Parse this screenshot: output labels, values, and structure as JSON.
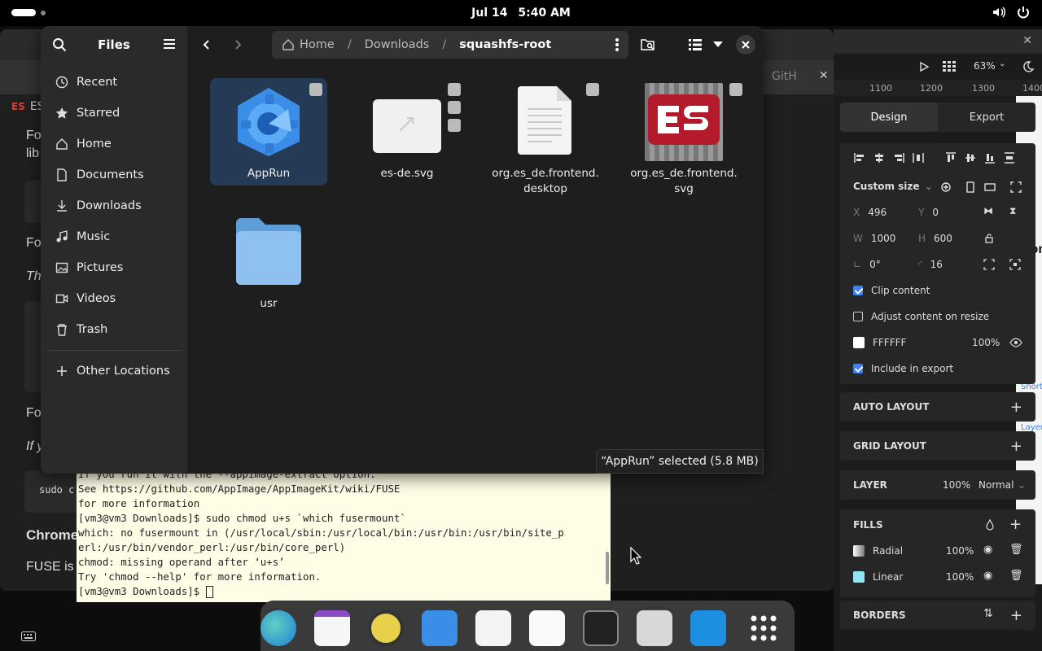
{
  "topbar": {
    "date": "Jul 14",
    "time": "5:40 AM",
    "icons": [
      "volume-icon",
      "power-icon"
    ]
  },
  "browser": {
    "tab_label": "ES",
    "fragments": [
      "Fo",
      "lib",
      "Fo",
      "Th",
      "Fo",
      "If y",
      "sudo c",
      "Chrome",
      "FUSE is"
    ],
    "github_tab": "GitH"
  },
  "files": {
    "title": "Files",
    "sidebar": {
      "items": [
        {
          "label": "Recent",
          "icon": "clock-icon"
        },
        {
          "label": "Starred",
          "icon": "star-icon"
        },
        {
          "label": "Home",
          "icon": "home-icon"
        },
        {
          "label": "Documents",
          "icon": "document-icon"
        },
        {
          "label": "Downloads",
          "icon": "download-icon"
        },
        {
          "label": "Music",
          "icon": "music-icon"
        },
        {
          "label": "Pictures",
          "icon": "picture-icon"
        },
        {
          "label": "Videos",
          "icon": "video-icon"
        },
        {
          "label": "Trash",
          "icon": "trash-icon"
        }
      ],
      "other_locations": "Other Locations"
    },
    "path": {
      "home": "Home",
      "downloads": "Downloads",
      "current": "squashfs-root"
    },
    "items": [
      {
        "name": "AppRun",
        "selected": true
      },
      {
        "name": "es-de.svg",
        "selected": false
      },
      {
        "name_line1": "org.es_de.frontend.",
        "name_line2": "desktop"
      },
      {
        "name_line1": "org.es_de.frontend.",
        "name_line2": "svg"
      },
      {
        "name": "usr"
      }
    ],
    "status": "“AppRun” selected  (5.8 MB)"
  },
  "terminal": {
    "lines": [
      "If you run it with the --appimage-extract option.",
      "See https://github.com/AppImage/AppImageKit/wiki/FUSE",
      "for more information",
      "[vm3@vm3 Downloads]$ sudo chmod u+s `which fusermount`",
      "which: no fusermount in (/usr/local/sbin:/usr/local/bin:/usr/bin:/usr/bin/site_p",
      "erl:/usr/bin/vendor_perl:/usr/bin/core_perl)",
      "chmod: missing operand after ‘u+s’",
      "Try 'chmod --help' for more information.",
      "[vm3@vm3 Downloads]$ "
    ]
  },
  "design": {
    "zoom": "63%",
    "ruler": [
      "1100",
      "1200",
      "1300",
      "1400"
    ],
    "tabs": {
      "design": "Design",
      "export": "Export"
    },
    "size_preset": "Custom size",
    "x_label": "X",
    "x": "496",
    "y_label": "Y",
    "y": "0",
    "w_label": "W",
    "w": "1000",
    "h_label": "H",
    "h": "600",
    "rotation": "0°",
    "radius": "16",
    "clip_content": "Clip content",
    "adjust_content": "Adjust content on resize",
    "fill_hex": "FFFFFF",
    "fill_opacity": "100%",
    "include_export": "Include in export",
    "auto_layout": "AUTO LAYOUT",
    "grid_layout": "GRID LAYOUT",
    "layer": "LAYER",
    "layer_opacity": "100%",
    "blend": "Normal",
    "fills": "FILLS",
    "fill1": {
      "name": "Radial",
      "opacity": "100%"
    },
    "fill2": {
      "name": "Linear",
      "opacity": "100%"
    },
    "borders": "BORDERS",
    "overflow_text": [
      "Conte",
      "Shortcut",
      "Layer pro"
    ]
  },
  "colors": {
    "accent": "#3b82f6",
    "selected_bg": "#243a55",
    "terminal_bg": "#fffde5",
    "folder": "#8fc1f0"
  }
}
